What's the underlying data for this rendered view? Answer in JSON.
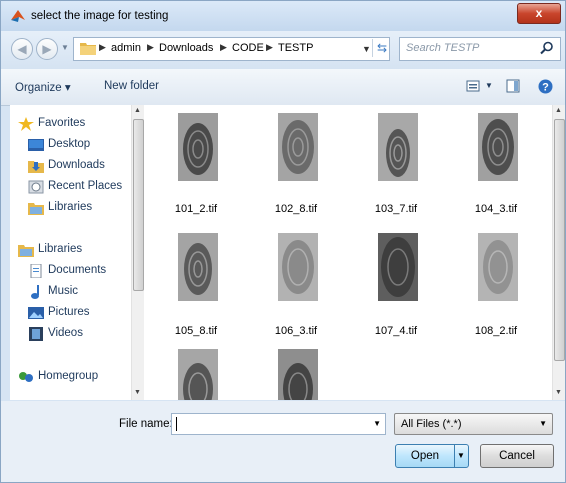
{
  "window": {
    "title": "select the image for testing",
    "close_label": "x"
  },
  "address": {
    "crumbs": [
      "admin",
      "Downloads",
      "CODE",
      "TESTP"
    ]
  },
  "search": {
    "placeholder": "Search TESTP"
  },
  "toolbar": {
    "organize_label": "Organize ▾",
    "new_folder_label": "New folder"
  },
  "sidebar": {
    "favorites": {
      "label": "Favorites",
      "items": [
        "Desktop",
        "Downloads",
        "Recent Places",
        "Libraries"
      ]
    },
    "libraries": {
      "label": "Libraries",
      "items": [
        "Documents",
        "Music",
        "Pictures",
        "Videos"
      ]
    },
    "homegroup": {
      "label": "Homegroup"
    }
  },
  "files": [
    "101_2.tif",
    "102_8.tif",
    "103_7.tif",
    "104_3.tif",
    "105_8.tif",
    "106_3.tif",
    "107_4.tif",
    "108_2.tif",
    "",
    ""
  ],
  "bottom": {
    "filename_label": "File name:",
    "filename_value": "",
    "filetype_value": "All Files (*.*)",
    "open_label": "Open",
    "cancel_label": "Cancel"
  },
  "colors": {
    "accent": "#1e395b",
    "close": "#c9452c",
    "thumb": "#9a9a9a"
  }
}
